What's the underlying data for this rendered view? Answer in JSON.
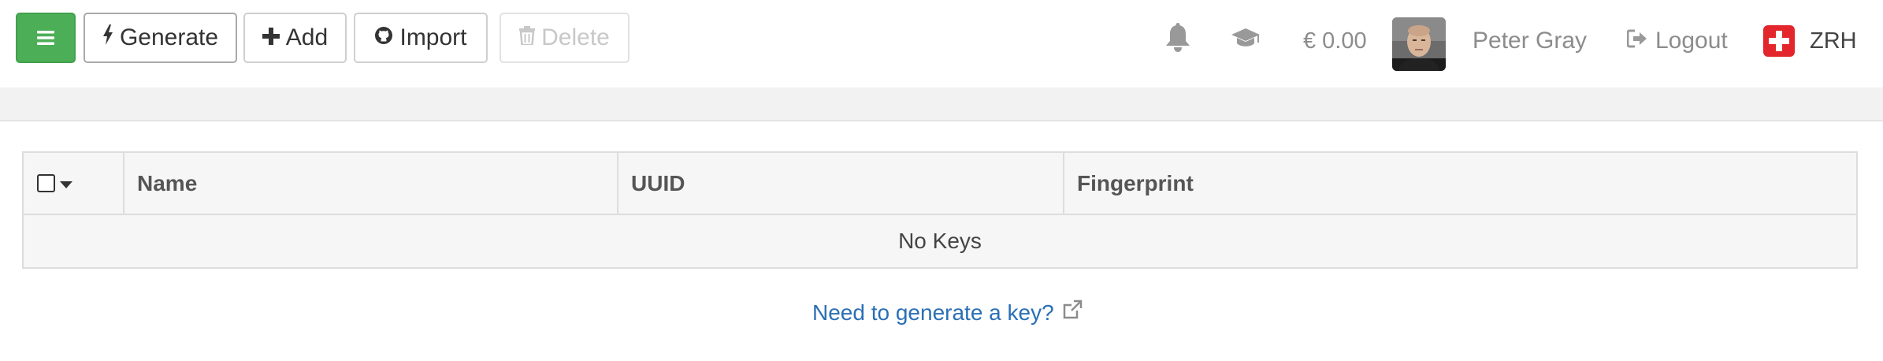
{
  "toolbar": {
    "menu_icon": "hamburger-icon",
    "generate_label": "Generate",
    "generate_icon": "bolt-icon",
    "add_label": "Add",
    "add_icon": "plus-icon",
    "import_label": "Import",
    "import_icon": "github-icon",
    "delete_label": "Delete",
    "delete_icon": "trash-icon",
    "menu_color": "#4cae56"
  },
  "header": {
    "notifications_icon": "bell-icon",
    "learning_icon": "graduation-cap-icon",
    "balance": "€ 0.00",
    "user_name": "Peter Gray",
    "logout_label": "Logout",
    "logout_icon": "sign-out-icon",
    "region_flag": "swiss-flag-icon",
    "region_code": "ZRH"
  },
  "table": {
    "columns": [
      "Name",
      "UUID",
      "Fingerprint"
    ],
    "empty_message": "No Keys"
  },
  "footer": {
    "help_link": "Need to generate a key?",
    "help_link_color": "#2a6fb5",
    "external_icon": "external-link-icon"
  }
}
